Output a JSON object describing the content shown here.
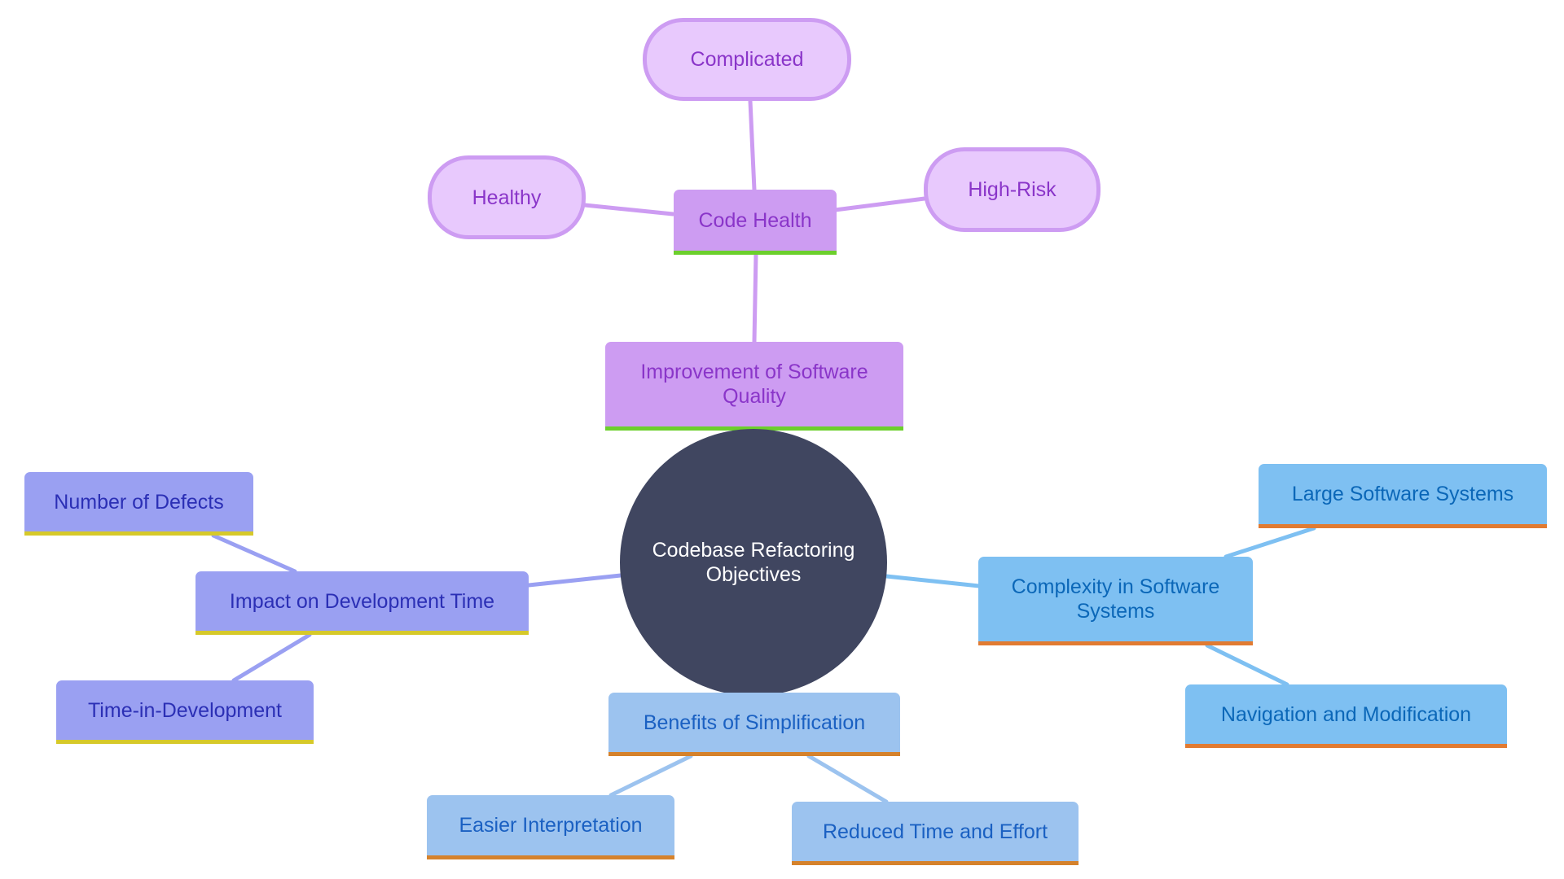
{
  "title": "Codebase Refactoring Objectives mind map",
  "colors": {
    "center": "#404660",
    "quality_branch": "#cd9cf2",
    "quality_leaf": "#e8c9fd",
    "time_branch": "#9aa0f2",
    "complexity_branch": "#7ec0f2",
    "simplification_branch": "#9cc3ef"
  },
  "root": {
    "label": "Codebase Refactoring Objectives"
  },
  "branches": {
    "quality": {
      "label": "Improvement of Software Quality",
      "child": {
        "label": "Code Health",
        "leaves": [
          "Complicated",
          "Healthy",
          "High-Risk"
        ]
      }
    },
    "time": {
      "label": "Impact on Development Time",
      "leaves": [
        "Number of Defects",
        "Time-in-Development"
      ]
    },
    "complexity": {
      "label": "Complexity in Software Systems",
      "leaves": [
        "Large Software Systems",
        "Navigation and Modification"
      ]
    },
    "simplification": {
      "label": "Benefits of Simplification",
      "leaves": [
        "Easier Interpretation",
        "Reduced Time and Effort"
      ]
    }
  }
}
